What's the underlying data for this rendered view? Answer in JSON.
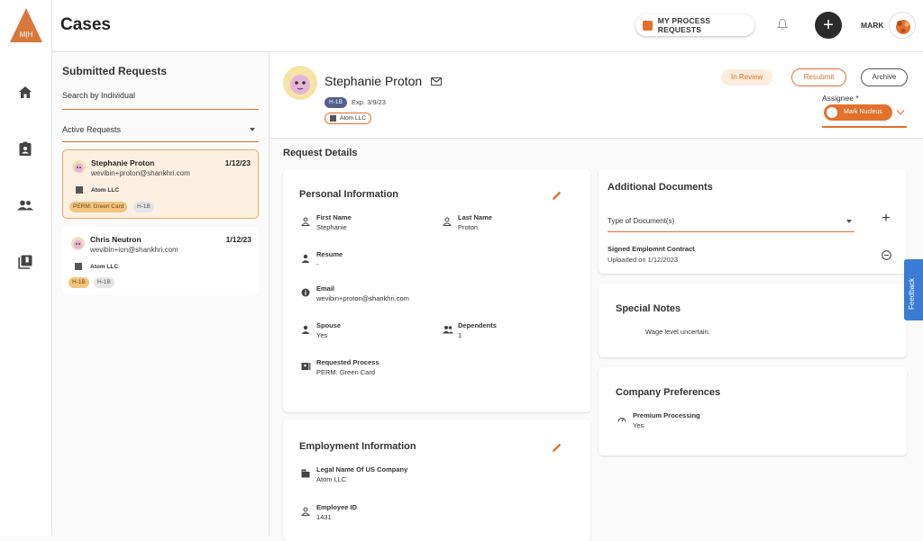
{
  "logo": {
    "text": "M|H"
  },
  "rail": {
    "items": [
      {
        "icon": "home-icon"
      },
      {
        "icon": "assignment-icon"
      },
      {
        "icon": "people-icon"
      },
      {
        "icon": "library-icon"
      }
    ]
  },
  "header": {
    "title": "Cases",
    "process_requests_label": "MY PROCESS REQUESTS",
    "add_label": "+",
    "user_name": "MARK"
  },
  "left_panel": {
    "title": "Submitted Requests",
    "search_placeholder": "Search by Individual",
    "filter_value": "Active Requests",
    "requests": [
      {
        "name": "Stephanie Proton",
        "date": "1/12/23",
        "email": "wevibin+proton@shankhri.com",
        "company": "Atom LLC",
        "tags": [
          "PERM: Green Card",
          "H-1B"
        ],
        "active": true
      },
      {
        "name": "Chris Neutron",
        "date": "1/12/23",
        "email": "wevibin+ion@shankhri.com",
        "company": "Atom LLC",
        "tags": [
          "H-1B",
          "H-1B"
        ],
        "active": false
      }
    ]
  },
  "profile": {
    "name": "Stephanie Proton",
    "visa": "H-1B",
    "expiry": "Exp. 3/9/23",
    "company": "Atom LLC",
    "status": "In Review",
    "resubmit_label": "Resubmit",
    "archive_label": "Archive",
    "assignee_label": "Assignee *",
    "assignee_name": "Mark Nucleus"
  },
  "request_details": {
    "title": "Request Details",
    "personal": {
      "title": "Personal Information",
      "first_name_label": "First Name",
      "first_name": "Stephanie",
      "last_name_label": "Last Name",
      "last_name": "Proton",
      "resume_label": "Resume",
      "resume": "-",
      "email_label": "Email",
      "email": "wevibin+proton@shankhri.com",
      "spouse_label": "Spouse",
      "spouse": "Yes",
      "dependents_label": "Dependents",
      "dependents": "1",
      "process_label": "Requested Process",
      "process": "PERM: Green Card"
    },
    "employment": {
      "title": "Employment Information",
      "company_label": "Legal Name Of US Company",
      "company": "Atom LLC",
      "employee_id_label": "Employee ID",
      "employee_id": "1431"
    }
  },
  "documents": {
    "title": "Additional Documents",
    "type_placeholder": "Type of Document(s)",
    "doc_name": "Signed Emplomnt Contract",
    "doc_date": "Uploaded on 1/12/2023"
  },
  "special_notes": {
    "title": "Special Notes",
    "text": "Wage level uncertain."
  },
  "company_prefs": {
    "title": "Company Preferences",
    "premium_label": "Premium Processing",
    "premium_value": "Yes"
  },
  "feedback_label": "Feedback",
  "colors": {
    "accent": "#e2712b",
    "feedback": "#3a7bd5",
    "visa_chip": "#555f8e"
  }
}
